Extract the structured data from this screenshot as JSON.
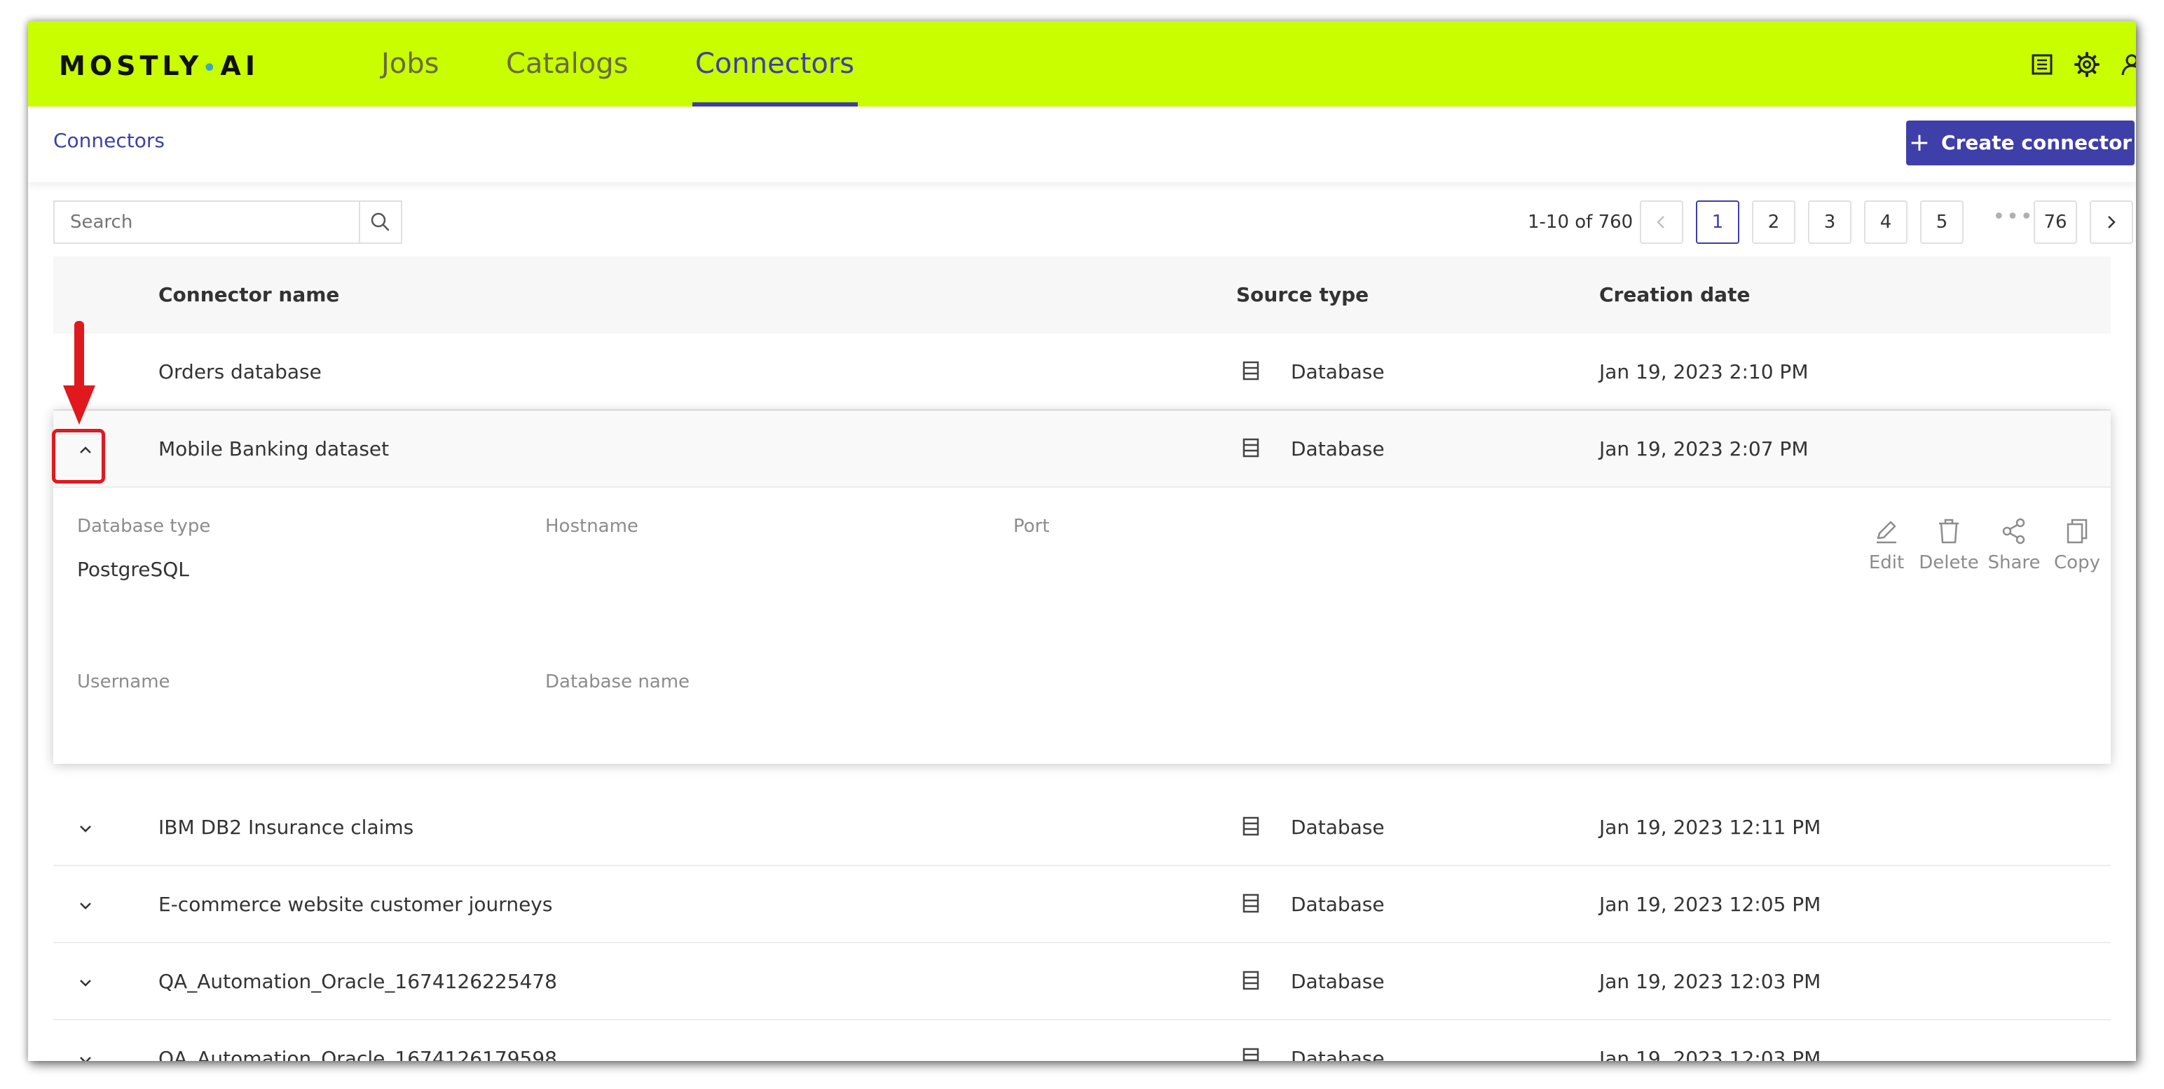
{
  "brand": {
    "logo_left": "MOSTLY",
    "logo_dot": "•",
    "logo_right": "AI",
    "accent_color": "#c8fe00",
    "primary_color": "#3e3fa8"
  },
  "nav": {
    "tabs": [
      {
        "label": "Jobs"
      },
      {
        "label": "Catalogs"
      },
      {
        "label": "Connectors",
        "active": true
      }
    ],
    "icons": [
      "docs-icon",
      "settings-gear-icon",
      "user-profile-icon"
    ]
  },
  "breadcrumb": {
    "label": "Connectors"
  },
  "create_button": {
    "plus": "+",
    "label": "Create connector"
  },
  "search": {
    "placeholder": "Search"
  },
  "pagination": {
    "range_text": "1-10 of 760",
    "pages": [
      "1",
      "2",
      "3",
      "4",
      "5"
    ],
    "current_page": "1",
    "ellipsis": "•••",
    "last_page": "76"
  },
  "table": {
    "headers": {
      "name": "Connector name",
      "source": "Source type",
      "date": "Creation date"
    },
    "rows": [
      {
        "name": "Orders database",
        "source": "Database",
        "date": "Jan 19, 2023 2:10 PM"
      },
      {
        "name": "Mobile Banking dataset",
        "source": "Database",
        "date": "Jan 19, 2023 2:07 PM",
        "expanded": true
      },
      {
        "name": "IBM DB2 Insurance claims",
        "source": "Database",
        "date": "Jan 19, 2023 12:11 PM"
      },
      {
        "name": "E-commerce website customer journeys",
        "source": "Database",
        "date": "Jan 19, 2023 12:05 PM"
      },
      {
        "name": "QA_Automation_Oracle_1674126225478",
        "source": "Database",
        "date": "Jan 19, 2023 12:03 PM"
      },
      {
        "name": "QA_Automation_Oracle_1674126179598",
        "source": "Database",
        "date": "Jan 19, 2023 12:03 PM"
      }
    ]
  },
  "details": {
    "database_type_label": "Database type",
    "database_type_value": "PostgreSQL",
    "hostname_label": "Hostname",
    "port_label": "Port",
    "username_label": "Username",
    "database_name_label": "Database name",
    "actions": [
      {
        "label": "Edit",
        "icon": "pencil-icon"
      },
      {
        "label": "Delete",
        "icon": "trash-icon"
      },
      {
        "label": "Share",
        "icon": "share-icon"
      },
      {
        "label": "Copy",
        "icon": "copy-icon"
      }
    ]
  },
  "annotation": {
    "color": "#e0191e"
  }
}
